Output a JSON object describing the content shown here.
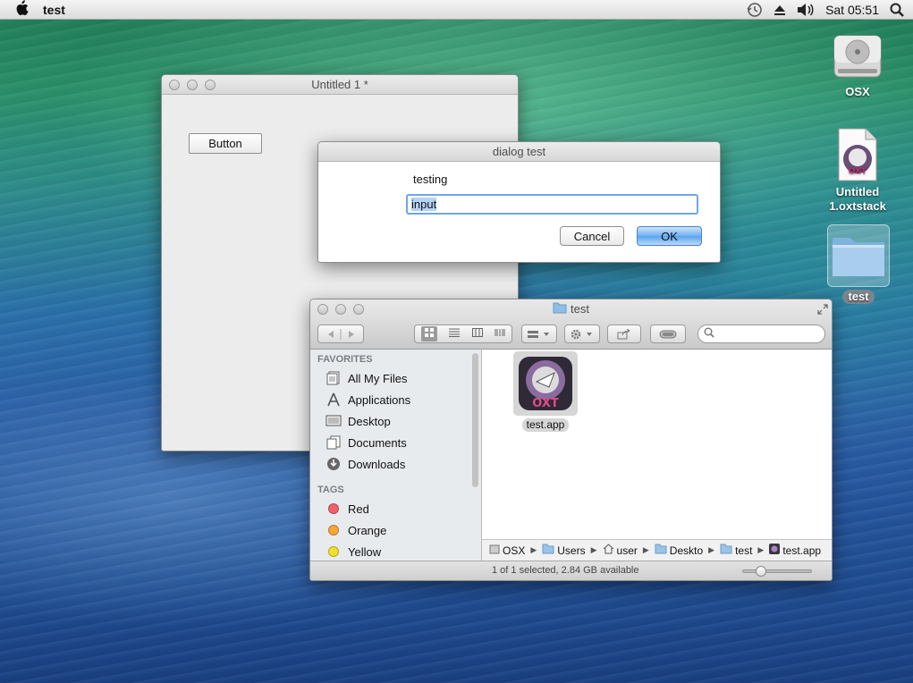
{
  "menubar": {
    "app_name": "test",
    "clock": "Sat 05:51"
  },
  "desktop": {
    "icons": [
      {
        "label": "OSX"
      },
      {
        "label": "Untitled 1.oxtstack"
      },
      {
        "label": "test"
      }
    ]
  },
  "stack_window": {
    "title": "Untitled 1 *",
    "button_label": "Button"
  },
  "dialog": {
    "title": "dialog test",
    "prompt": "testing",
    "input_value": "input",
    "cancel_label": "Cancel",
    "ok_label": "OK"
  },
  "finder": {
    "title": "test",
    "sidebar": {
      "favorites_header": "FAVORITES",
      "favorites": [
        {
          "label": "All My Files",
          "icon": "all-files-icon"
        },
        {
          "label": "Applications",
          "icon": "applications-icon"
        },
        {
          "label": "Desktop",
          "icon": "desktop-icon"
        },
        {
          "label": "Documents",
          "icon": "documents-icon"
        },
        {
          "label": "Downloads",
          "icon": "downloads-icon"
        }
      ],
      "tags_header": "TAGS",
      "tags": [
        {
          "label": "Red",
          "color": "#f0626b"
        },
        {
          "label": "Orange",
          "color": "#f7a63a"
        },
        {
          "label": "Yellow",
          "color": "#f2e12b"
        }
      ]
    },
    "files": [
      {
        "name": "test.app"
      }
    ],
    "path": [
      "OSX",
      "Users",
      "user",
      "Deskto",
      "test",
      "test.app"
    ],
    "status": "1 of 1 selected, 2.84 GB available"
  }
}
